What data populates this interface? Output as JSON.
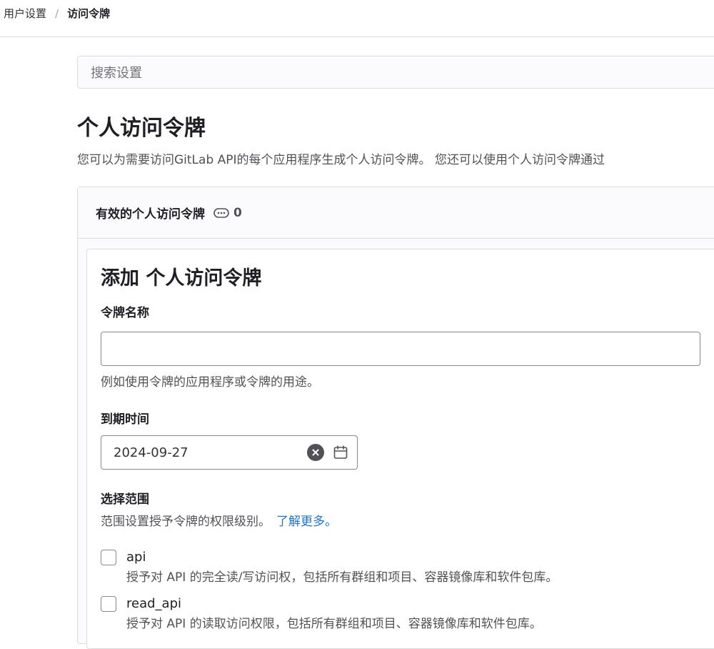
{
  "breadcrumb": {
    "parent": "用户设置",
    "separator": "/",
    "current": "访问令牌"
  },
  "search": {
    "placeholder": "搜索设置"
  },
  "page": {
    "title": "个人访问令牌",
    "description": "您可以为需要访问GitLab API的每个应用程序生成个人访问令牌。 您还可以使用个人访问令牌通过"
  },
  "active_tokens": {
    "title": "有效的个人访问令牌",
    "count": "0",
    "icon": "token-icon"
  },
  "form": {
    "title": "添加 个人访问令牌",
    "name_label": "令牌名称",
    "name_value": "",
    "name_help": "例如使用令牌的应用程序或令牌的用途。",
    "expiry_label": "到期时间",
    "expiry_value": "2024-09-27",
    "scope_label": "选择范围",
    "scope_help": "范围设置授予令牌的权限级别。",
    "learn_more": "了解更多。",
    "scopes": [
      {
        "name": "api",
        "description": "授予对 API 的完全读/写访问权，包括所有群组和项目、容器镜像库和软件包库。",
        "checked": false
      },
      {
        "name": "read_api",
        "description": "授予对 API 的读取访问权限，包括所有群组和项目、容器镜像库和软件包库。",
        "checked": false
      }
    ]
  },
  "colors": {
    "link": "#1f75cb",
    "text": "#333238",
    "border": "#dcdcde"
  }
}
